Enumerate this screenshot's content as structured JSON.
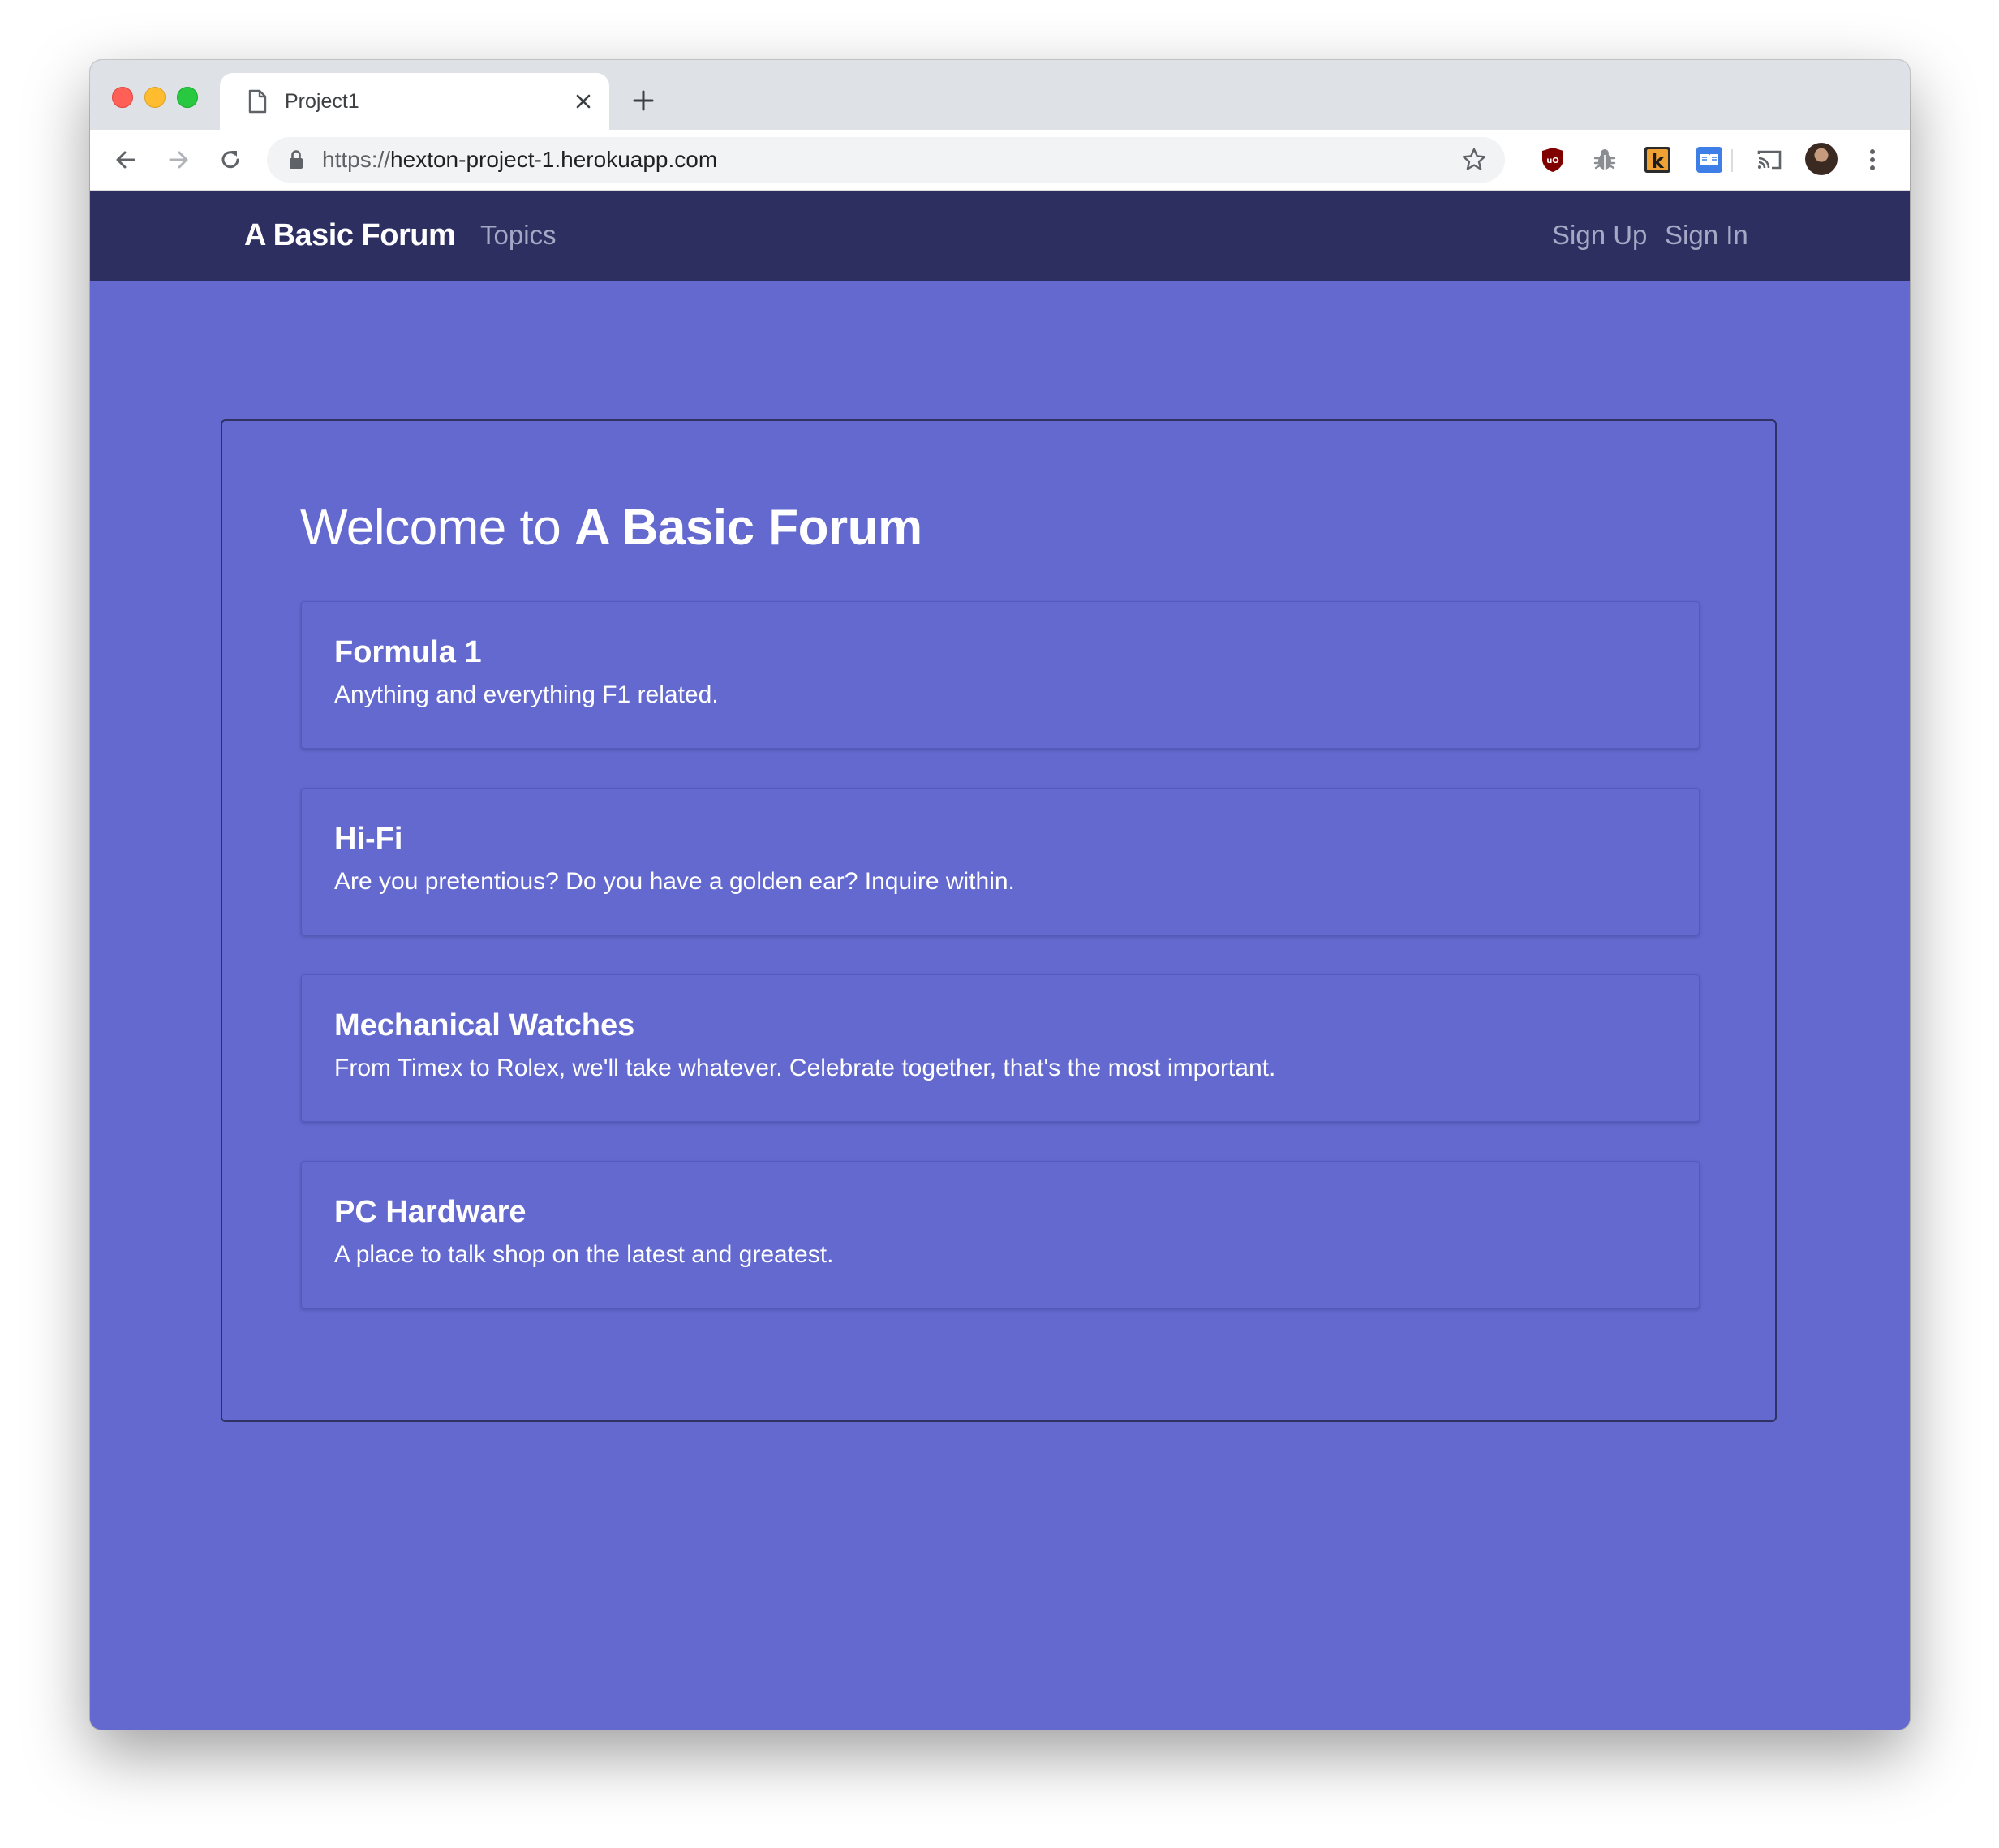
{
  "browser": {
    "tab_title": "Project1",
    "url_scheme": "https://",
    "url_host": "hexton-project-1.herokuapp.com",
    "icons": {
      "tab": "document-icon",
      "close": "close-icon",
      "new_tab": "plus-icon",
      "back": "arrow-left-icon",
      "forward": "arrow-right-icon",
      "reload": "reload-icon",
      "lock": "lock-icon",
      "bookmark": "star-icon",
      "extensions": [
        "ublock-origin-icon",
        "bug-icon",
        "k-extension-icon",
        "reader-icon"
      ],
      "cast": "cast-icon",
      "menu": "kebab-menu-icon"
    }
  },
  "navbar": {
    "brand": "A Basic Forum",
    "links": [
      "Topics"
    ],
    "auth_links": [
      "Sign Up",
      "Sign In"
    ]
  },
  "main": {
    "welcome_prefix": "Welcome to",
    "welcome_strong": "A Basic Forum",
    "topics": [
      {
        "title": "Formula 1",
        "description": "Anything and everything F1 related."
      },
      {
        "title": "Hi-Fi",
        "description": "Are you pretentious? Do you have a golden ear? Inquire within."
      },
      {
        "title": "Mechanical Watches",
        "description": "From Timex to Rolex, we'll take whatever. Celebrate together, that's the most important."
      },
      {
        "title": "PC Hardware",
        "description": "A place to talk shop on the latest and greatest."
      }
    ]
  },
  "colors": {
    "navbar_bg": "#2c2f60",
    "page_bg": "#6369cf",
    "nav_link": "#a5a8c5",
    "text": "#ffffff"
  }
}
